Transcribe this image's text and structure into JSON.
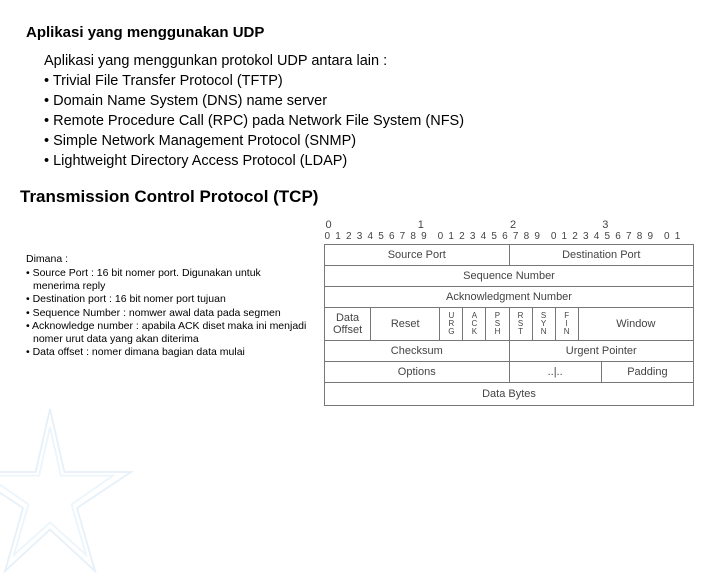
{
  "section1": {
    "title": "Aplikasi yang menggunakan UDP",
    "intro": "Aplikasi yang menggunkan protokol UDP antara lain :",
    "items": [
      "Trivial File Transfer Protocol (TFTP)",
      "Domain Name System (DNS) name server",
      "Remote Procedure Call (RPC) pada Network File System (NFS)",
      "Simple Network Management Protocol (SNMP)",
      "Lightweight Directory Access Protocol (LDAP)"
    ]
  },
  "section2": {
    "title": "Transmission Control Protocol (TCP)"
  },
  "dimana": {
    "label": "Dimana :",
    "items": [
      "Source Port : 16 bit nomer port. Digunakan untuk menerima reply",
      "Destination port : 16 bit nomer port tujuan",
      "Sequence Number : nomwer awal data pada segmen",
      "Acknowledge number : apabila ACK diset maka ini menjadi nomer urut data yang akan diterima",
      "Data offset : nomer dimana bagian data mulai"
    ]
  },
  "tcp": {
    "bit_majors": [
      "0",
      "1",
      "2",
      "3"
    ],
    "bit_rows": [
      "0 1 2 3 4 5 6 7 8 9",
      "0 1 2 3 4 5 6 7 8 9",
      "0 1 2 3 4 5 6 7 8 9",
      "0 1"
    ],
    "source_port": "Source Port",
    "dest_port": "Destination Port",
    "seq": "Sequence Number",
    "ack": "Acknowledgment Number",
    "data_offset": "Data\nOffset",
    "reset": "Reset",
    "flags": [
      {
        "t": "U",
        "m": "R",
        "b": "G"
      },
      {
        "t": "A",
        "m": "C",
        "b": "K"
      },
      {
        "t": "P",
        "m": "S",
        "b": "H"
      },
      {
        "t": "R",
        "m": "S",
        "b": "T"
      },
      {
        "t": "S",
        "m": "Y",
        "b": "N"
      },
      {
        "t": "F",
        "m": "I",
        "b": "N"
      }
    ],
    "window": "Window",
    "checksum": "Checksum",
    "urgent": "Urgent Pointer",
    "options": "Options",
    "options_dots": "..|..",
    "padding": "Padding",
    "data_bytes": "Data Bytes"
  }
}
